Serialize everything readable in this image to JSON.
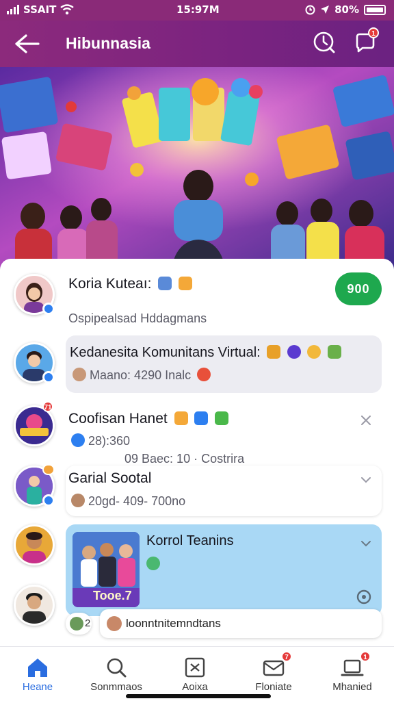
{
  "status": {
    "carrier": "SSAIT",
    "time": "15:97M",
    "battery": "80%"
  },
  "header": {
    "title": "Hibunnasia",
    "notif_badge": "1"
  },
  "items": [
    {
      "title": "Koria Kuteaı:",
      "subtitle": "Ospipealsad Hddagmans",
      "join_label": "900"
    },
    {
      "title": "Kedanesita Komunitans Virtual:",
      "subtitle": "Maano: 4290 Inalc"
    },
    {
      "title": "Coofisan Hanet",
      "subtitle": "28):360",
      "badge": "71",
      "stats": "09   Baec: 10 · Costrira"
    },
    {
      "title": "Garial Sootal",
      "subtitle": "20gd- 409- 700no"
    },
    {
      "title": "Korrol Teanins",
      "thumb_label": "Tooe.7",
      "reply_prefix": "2",
      "reply_text": "loonntnitemndtans"
    }
  ],
  "tabs": [
    {
      "label": "Heane"
    },
    {
      "label": "Sonmmaos"
    },
    {
      "label": "Aoixa"
    },
    {
      "label": "Floniate",
      "badge": "7"
    },
    {
      "label": "Mhanied",
      "badge": "1"
    }
  ],
  "colors": {
    "header": "#7a2380",
    "accent": "#2a6de0",
    "join": "#1ea84e",
    "badge": "#e53a3a"
  }
}
